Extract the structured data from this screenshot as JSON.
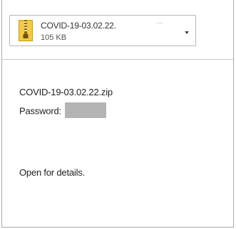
{
  "attachment": {
    "name": "COVID-19-03.02.22.",
    "ellipsis": "···",
    "size": "105 KB",
    "icon": "zip-file-icon"
  },
  "message": {
    "filename_line": "COVID-19-03.02.22.zip",
    "password_label": "Password:",
    "password_value": "[redacted]",
    "body_line": "Open for details."
  },
  "colors": {
    "border": "#a9a9a9",
    "zip_folder": "#f2c94c",
    "zip_stripe": "#e0a800",
    "redaction": "#b4b4b4"
  }
}
